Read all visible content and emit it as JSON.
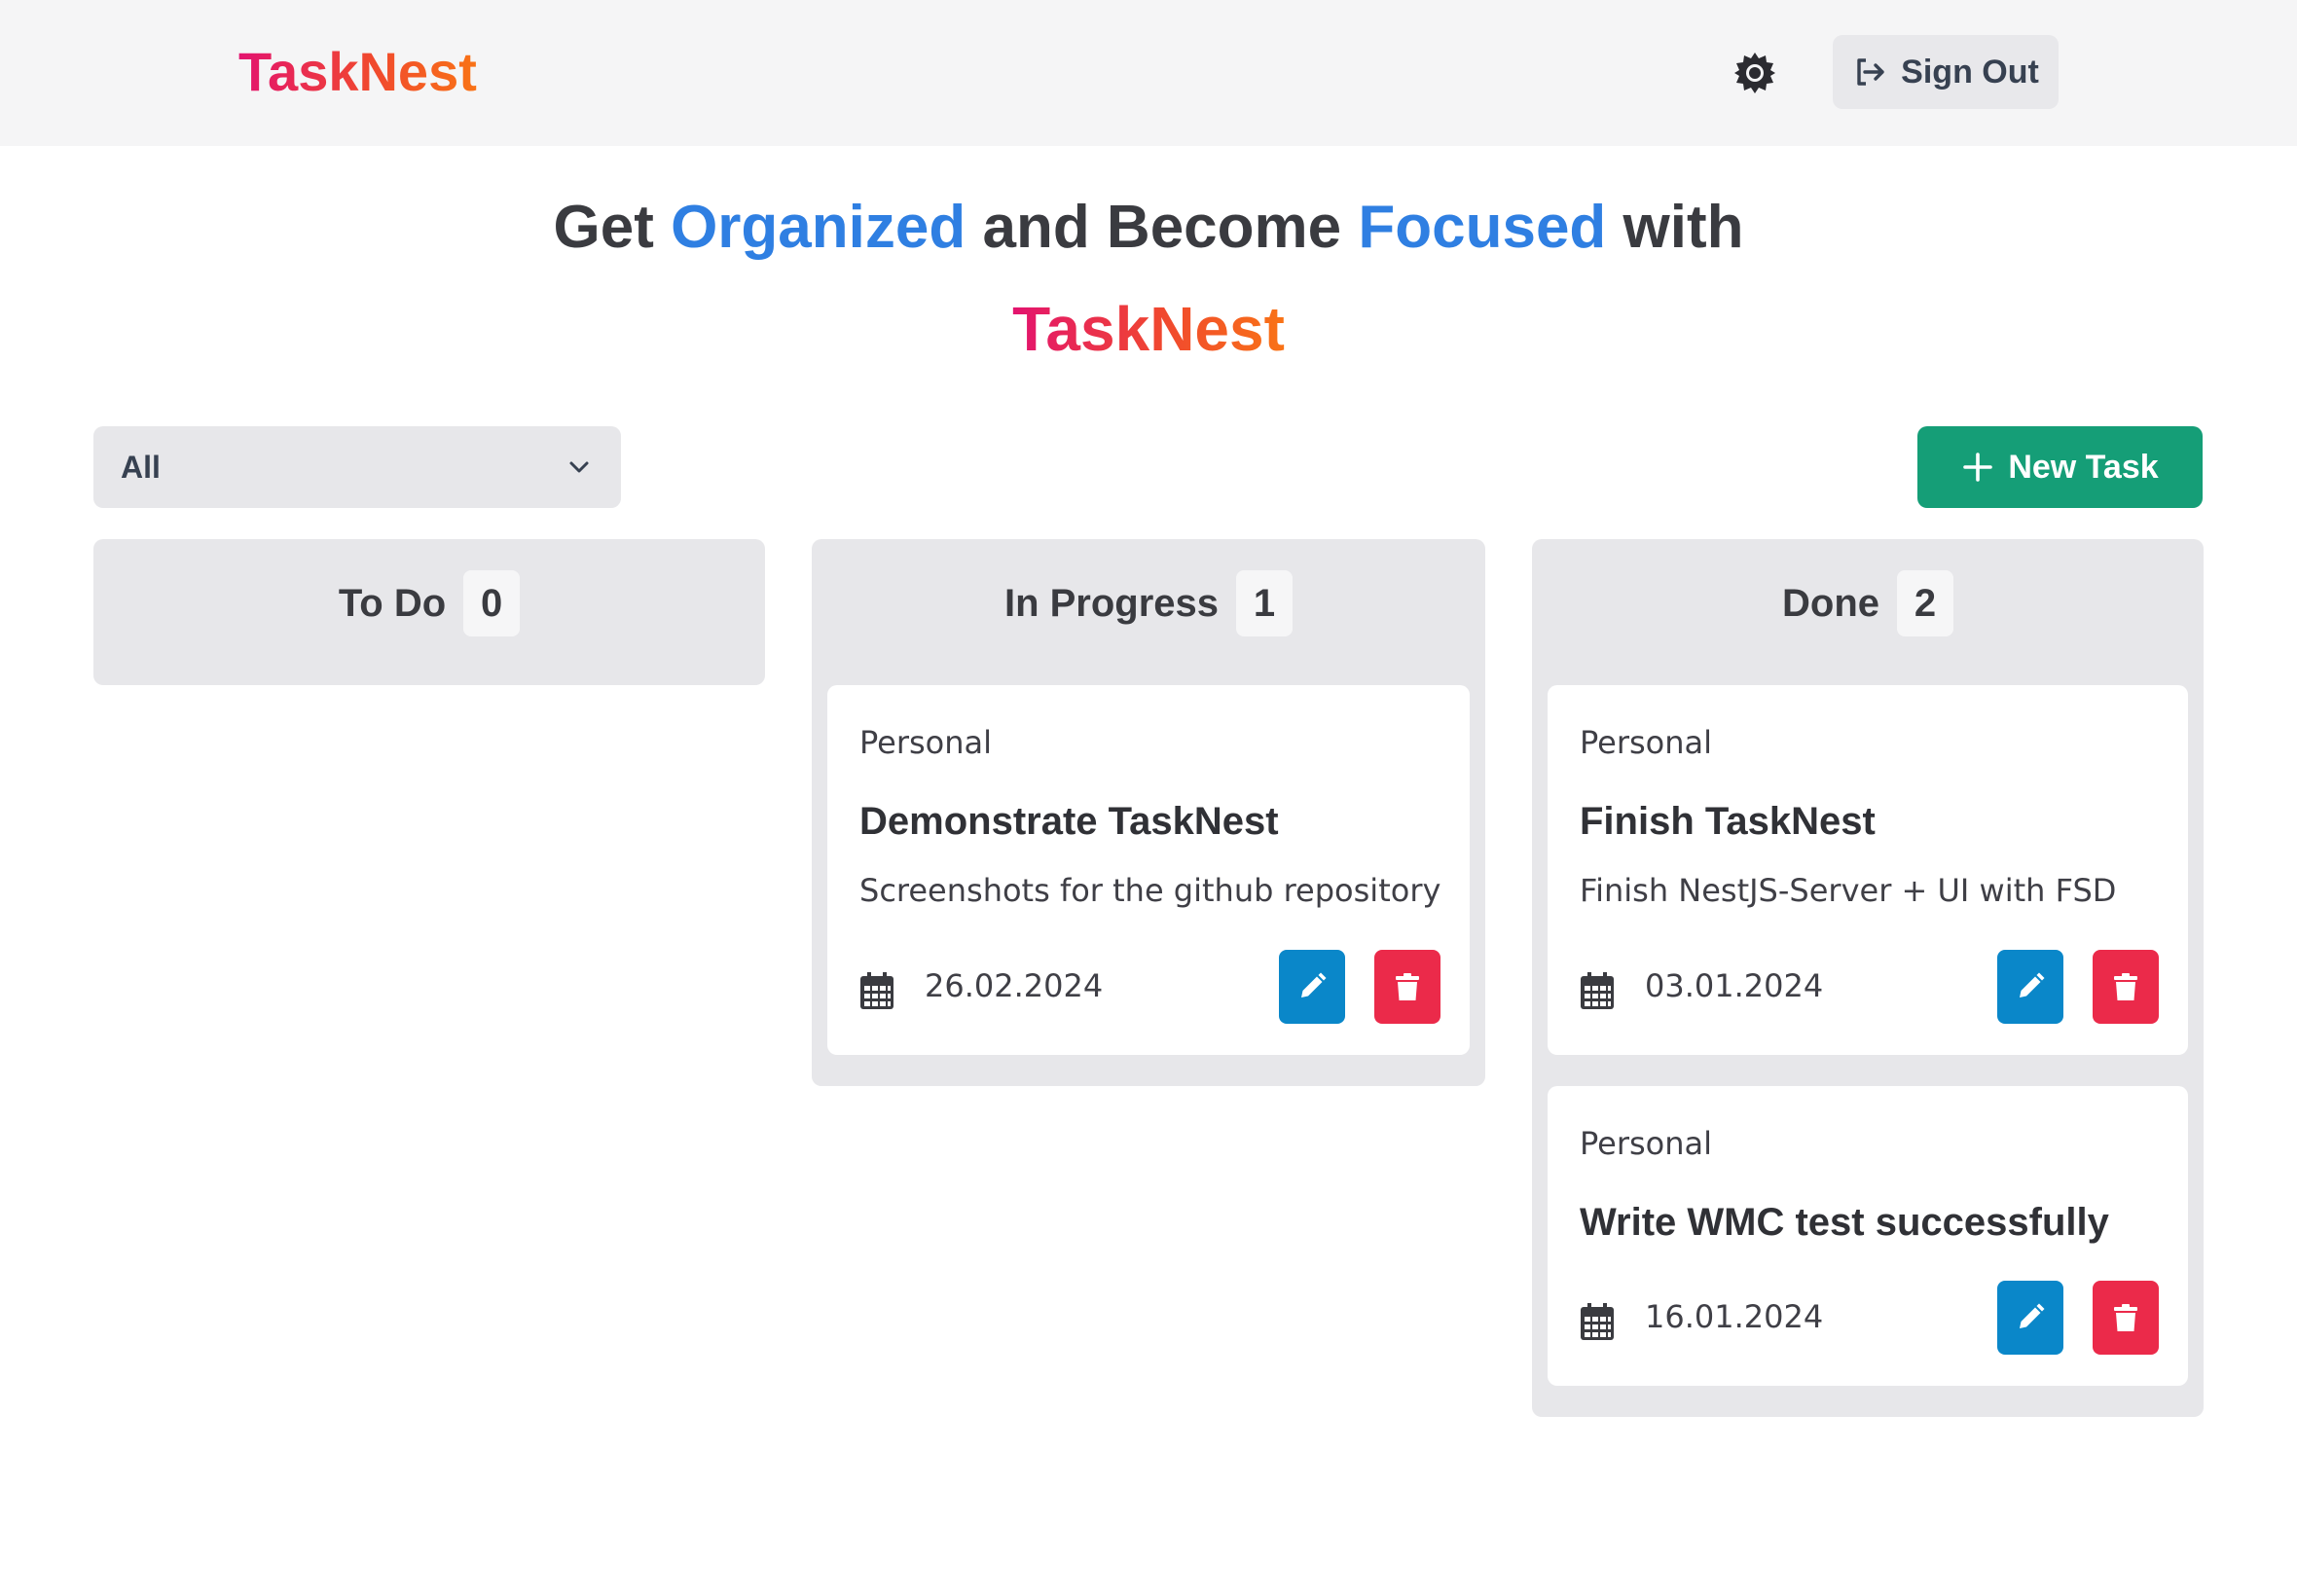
{
  "app": {
    "brand": "TaskNest"
  },
  "header": {
    "theme_icon": "sun-gear-icon",
    "signout_label": "Sign Out",
    "signout_icon": "sign-out-icon"
  },
  "hero": {
    "part1": "Get ",
    "accent1": "Organized",
    "part2": " and Become ",
    "accent2": "Focused",
    "part3": " with",
    "brand": "TaskNest"
  },
  "toolbar": {
    "filter_value": "All",
    "new_task_label": "New Task"
  },
  "colors": {
    "accent_blue": "#2f7fe2",
    "new_task_green": "#159e77",
    "edit_blue": "#0a87c9",
    "delete_red": "#eb2a4a",
    "brand_gradient_start": "#e3136f",
    "brand_gradient_end": "#f97316"
  },
  "columns": [
    {
      "title": "To Do",
      "count": "0",
      "tasks": []
    },
    {
      "title": "In Progress",
      "count": "1",
      "tasks": [
        {
          "category": "Personal",
          "title": "Demonstrate TaskNest",
          "description": "Screenshots for the github repository",
          "date": "26.02.2024"
        }
      ]
    },
    {
      "title": "Done",
      "count": "2",
      "tasks": [
        {
          "category": "Personal",
          "title": "Finish TaskNest",
          "description": "Finish NestJS-Server + UI with FSD",
          "date": "03.01.2024"
        },
        {
          "category": "Personal",
          "title": "Write WMC test successfully",
          "description": "",
          "date": "16.01.2024"
        }
      ]
    }
  ]
}
